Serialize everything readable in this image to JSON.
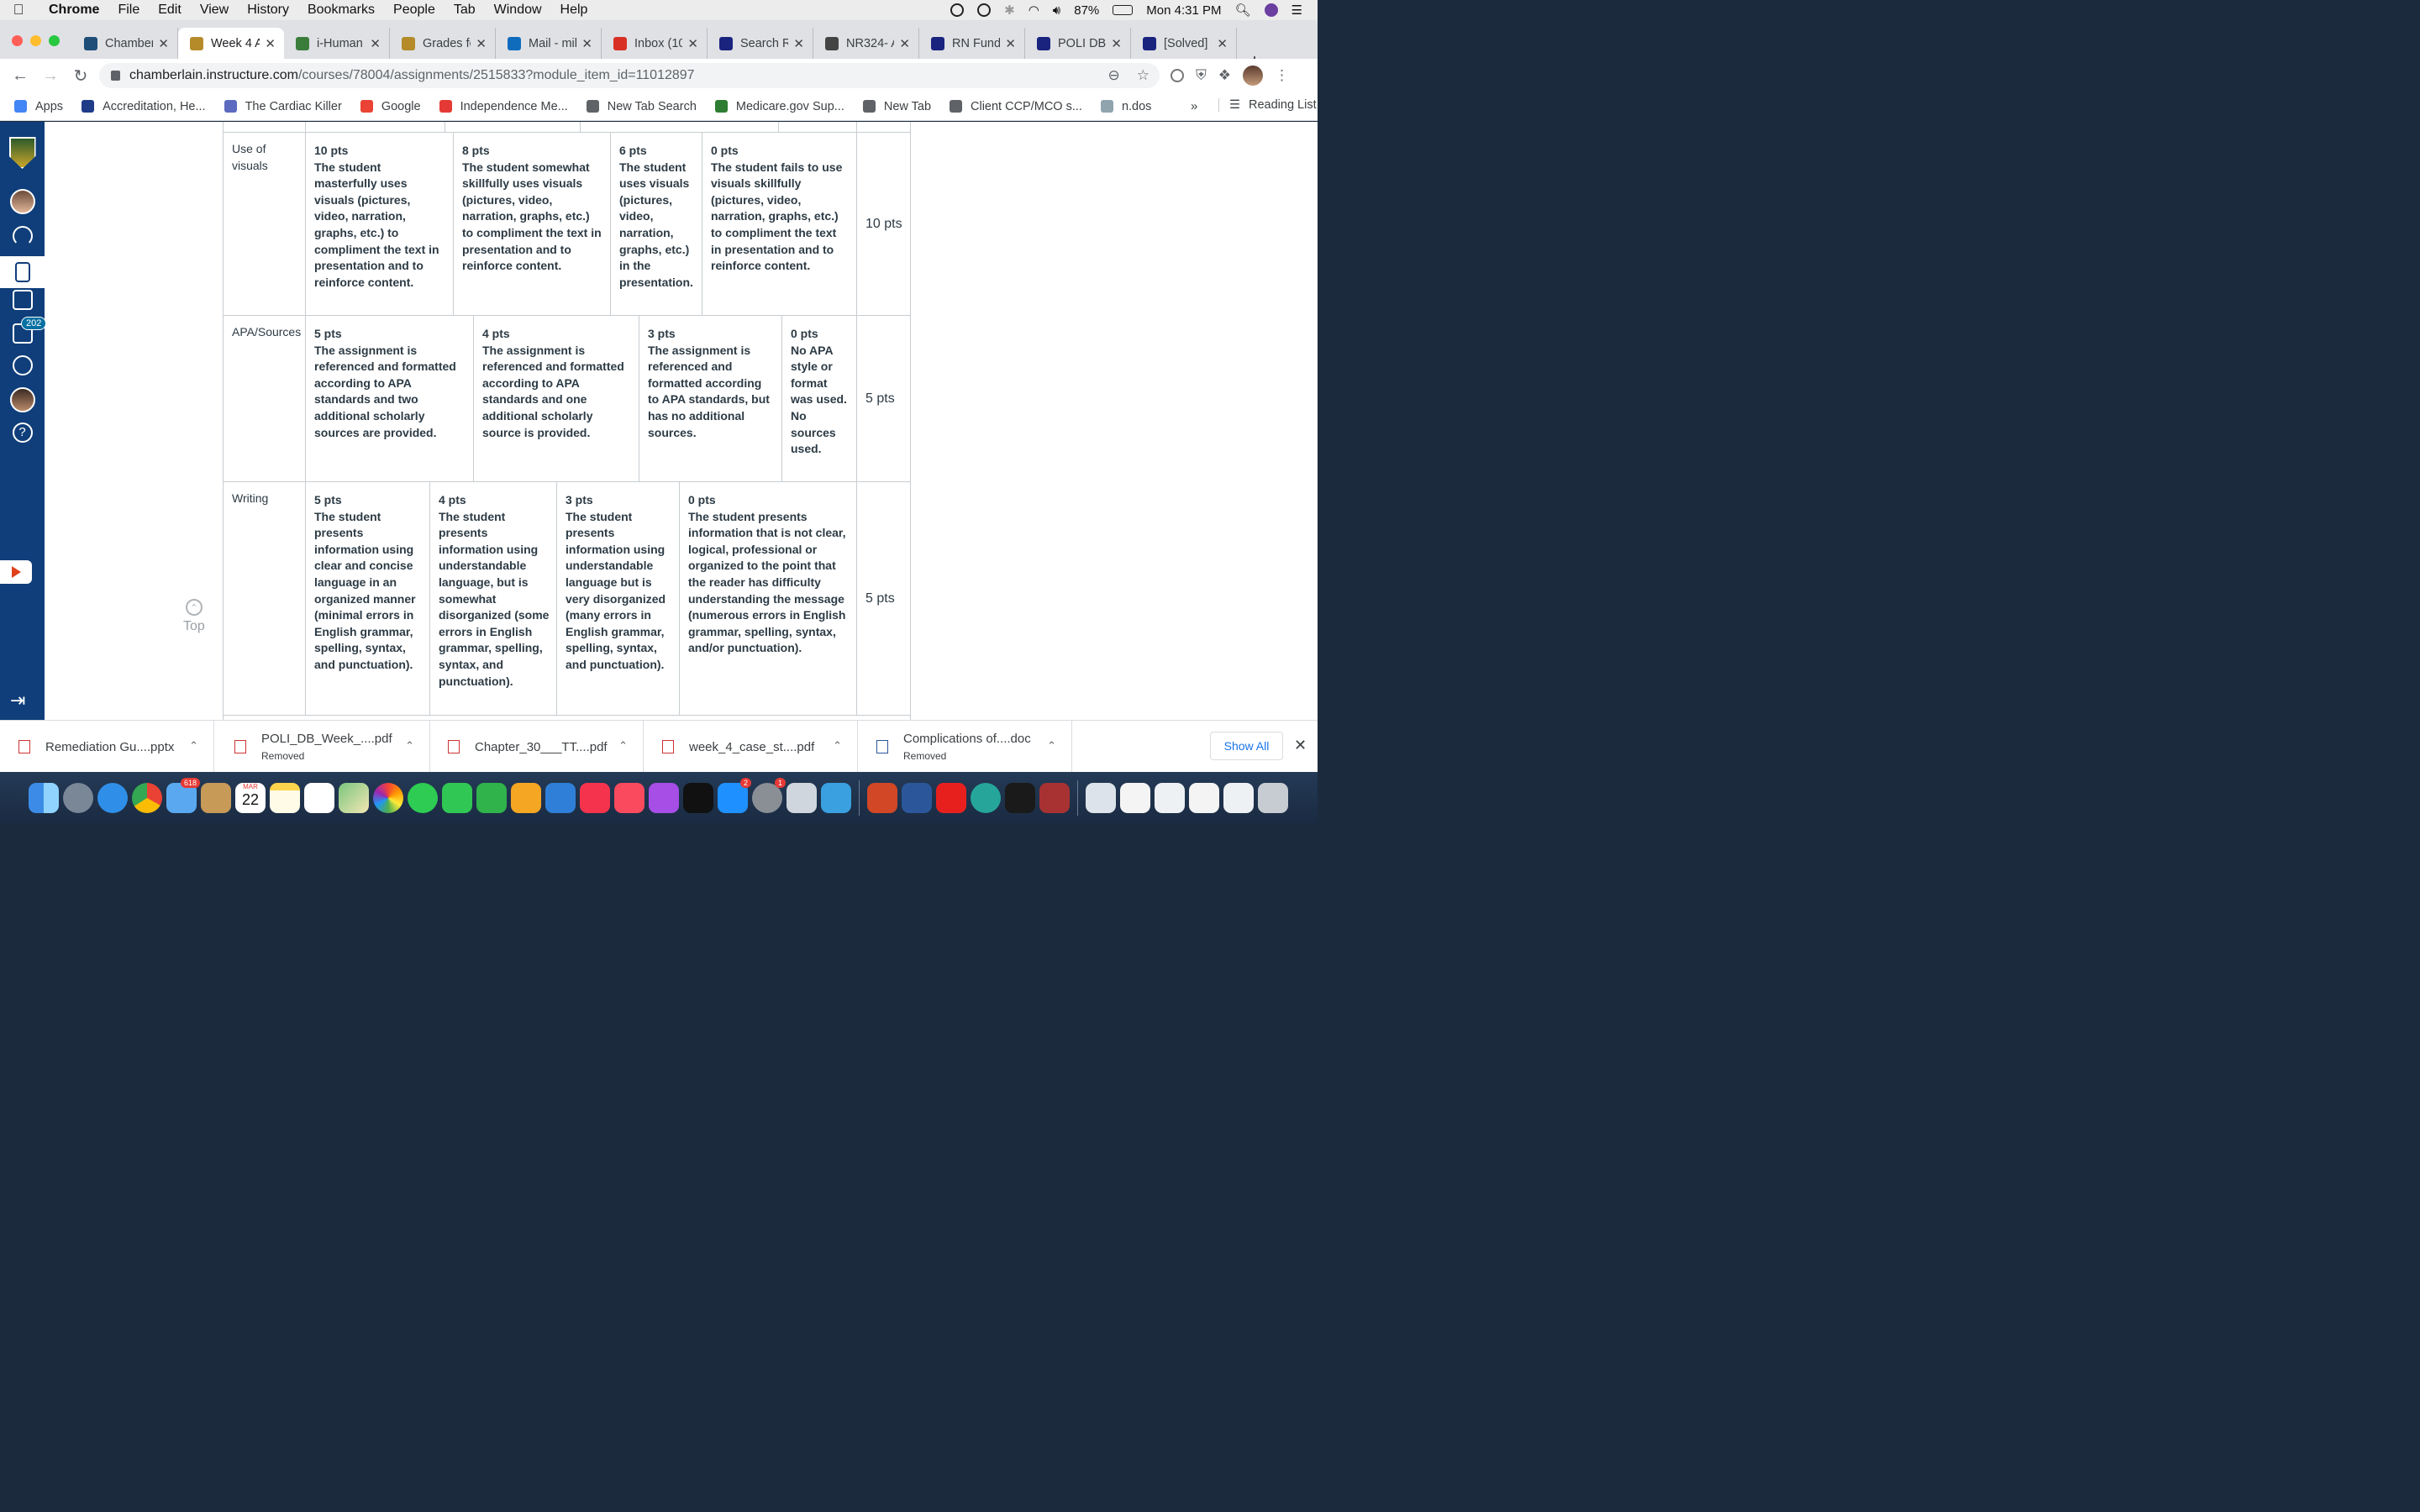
{
  "menubar": {
    "app": "Chrome",
    "items": [
      "File",
      "Edit",
      "View",
      "History",
      "Bookmarks",
      "People",
      "Tab",
      "Window",
      "Help"
    ],
    "battery": "87%",
    "clock": "Mon 4:31 PM"
  },
  "tabs": [
    {
      "label": "Chamber",
      "color": "#1f4e79"
    },
    {
      "label": "Week 4 A",
      "color": "#b58b2a"
    },
    {
      "label": "i-Human",
      "color": "#3a7d3a"
    },
    {
      "label": "Grades fo",
      "color": "#b58b2a"
    },
    {
      "label": "Mail - mil",
      "color": "#0f6cbd"
    },
    {
      "label": "Inbox (10",
      "color": "#d93025"
    },
    {
      "label": "Search R",
      "color": "#1a237e"
    },
    {
      "label": "NR324- A",
      "color": "#444444"
    },
    {
      "label": "RN Fund",
      "color": "#1a237e"
    },
    {
      "label": "POLI DB",
      "color": "#1a237e"
    },
    {
      "label": "[Solved]",
      "color": "#1a237e"
    }
  ],
  "omnibox": {
    "host": "chamberlain.instructure.com",
    "path": "/courses/78004/assignments/2515833?module_item_id=11012897"
  },
  "bookmarks": [
    {
      "label": "Apps",
      "color": "#4285f4"
    },
    {
      "label": "Accreditation, He...",
      "color": "#1f3c88"
    },
    {
      "label": "The Cardiac Killer",
      "color": "#5c6bc0"
    },
    {
      "label": "Google",
      "color": "#ea4335"
    },
    {
      "label": "Independence Me...",
      "color": "#e53935"
    },
    {
      "label": "New Tab Search",
      "color": "#5f6368"
    },
    {
      "label": "Medicare.gov Sup...",
      "color": "#2e7d32"
    },
    {
      "label": "New Tab",
      "color": "#5f6368"
    },
    {
      "label": "Client CCP/MCO s...",
      "color": "#5f6368"
    },
    {
      "label": "n.dos",
      "color": "#90a4ae"
    }
  ],
  "bookmarks_more": "»",
  "reading_list": "Reading List",
  "lms": {
    "inbox_count": "202",
    "top_label": "Top"
  },
  "rubric": [
    {
      "criterion": "Use of visuals",
      "points": "10 pts",
      "ratings": [
        {
          "pts": "10 pts",
          "desc": "The student masterfully uses visuals (pictures, video, narration, graphs, etc.) to compliment the text in presentation and to reinforce content."
        },
        {
          "pts": "8 pts",
          "desc": "The student somewhat skillfully uses visuals (pictures, video, narration, graphs, etc.) to compliment the text in presentation and to reinforce content."
        },
        {
          "pts": "6 pts",
          "desc": "The student uses visuals (pictures, video, narration, graphs, etc.) in the presentation."
        },
        {
          "pts": "0 pts",
          "desc": "The student fails to use visuals skillfully (pictures, video, narration, graphs, etc.) to compliment the text in presentation and to reinforce content."
        }
      ]
    },
    {
      "criterion": "APA/Sources",
      "points": "5 pts",
      "ratings": [
        {
          "pts": "5 pts",
          "desc": "The assignment is referenced and formatted according to APA standards and two additional scholarly sources are provided."
        },
        {
          "pts": "4 pts",
          "desc": "The assignment is referenced and formatted according to APA standards and one additional scholarly source is provided."
        },
        {
          "pts": "3 pts",
          "desc": "The assignment is referenced and formatted according to APA standards, but has no additional sources."
        },
        {
          "pts": "0 pts",
          "desc": "No APA style or format was used. No sources used."
        }
      ]
    },
    {
      "criterion": "Writing",
      "points": "5 pts",
      "ratings": [
        {
          "pts": "5 pts",
          "desc": "The student presents information using clear and concise language in an organized manner (minimal errors in English grammar, spelling, syntax, and punctuation)."
        },
        {
          "pts": "4 pts",
          "desc": "The student presents information using understandable language, but is somewhat disorganized (some errors in English grammar, spelling, syntax, and punctuation)."
        },
        {
          "pts": "3 pts",
          "desc": "The student presents information using understandable language but is very disorganized (many errors in English grammar, spelling, syntax, and punctuation)."
        },
        {
          "pts": "0 pts",
          "desc": "The student presents information that is not clear, logical, professional or organized to the point that the reader has difficulty understanding the message (numerous errors in English grammar, spelling, syntax, and/or punctuation)."
        }
      ]
    }
  ],
  "downloads": [
    {
      "name": "Remediation Gu....pptx",
      "status": "",
      "type": "pptx"
    },
    {
      "name": "POLI_DB_Week_....pdf",
      "status": "Removed",
      "type": "pdf"
    },
    {
      "name": "Chapter_30___TT....pdf",
      "status": "",
      "type": "pdf"
    },
    {
      "name": "week_4_case_st....pdf",
      "status": "",
      "type": "pdf"
    },
    {
      "name": "Complications of....doc",
      "status": "Removed",
      "type": "doc"
    }
  ],
  "downloads_show_all": "Show All",
  "dock": {
    "mail_badge": "618",
    "calendar_month": "MAR",
    "calendar_day": "22",
    "appstore_badge": "2",
    "settings_badge": "1"
  }
}
